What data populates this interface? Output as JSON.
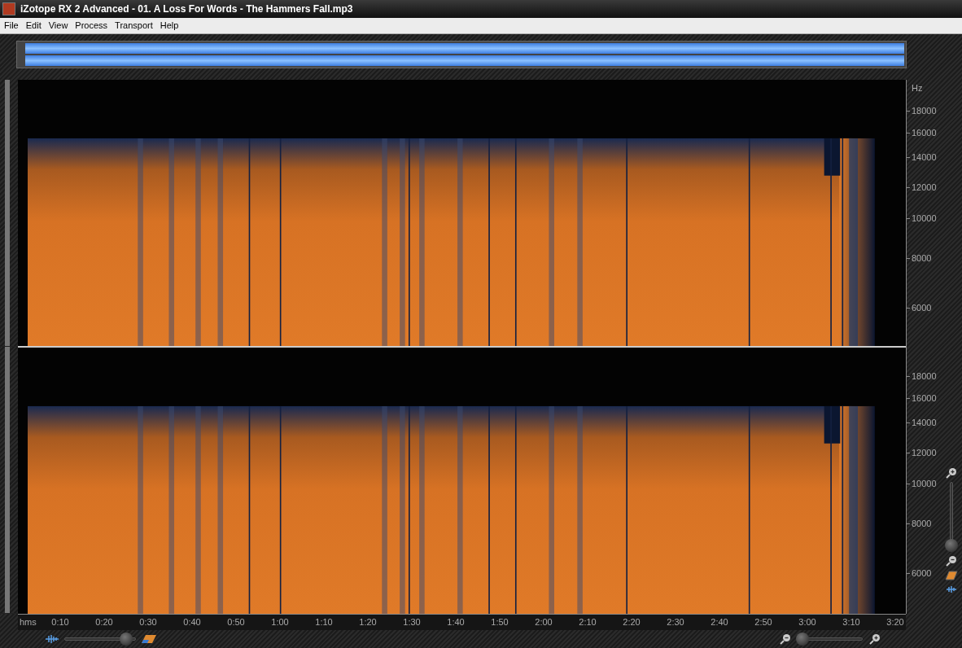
{
  "window": {
    "title": "iZotope RX 2 Advanced - 01. A Loss For Words - The Hammers Fall.mp3"
  },
  "menu": [
    "File",
    "Edit",
    "View",
    "Process",
    "Transport",
    "Help"
  ],
  "channels": [
    {
      "unit": "Hz",
      "frequency_labels": [
        "18000",
        "16000",
        "14000",
        "12000",
        "10000",
        "8000",
        "6000"
      ]
    },
    {
      "frequency_labels": [
        "18000",
        "16000",
        "14000",
        "12000",
        "10000",
        "8000",
        "6000"
      ]
    }
  ],
  "time_axis": {
    "unit": "hms",
    "labels": [
      "0:10",
      "0:20",
      "0:30",
      "0:40",
      "0:50",
      "1:00",
      "1:10",
      "1:20",
      "1:30",
      "1:40",
      "1:50",
      "2:00",
      "2:10",
      "2:20",
      "2:30",
      "2:40",
      "2:50",
      "3:00",
      "3:10",
      "3:20"
    ]
  },
  "blend_slider": {
    "level": 0.88
  },
  "horizontal_zoom": {
    "level": 0.05
  },
  "vertical_zoom": {
    "level": 0.0
  }
}
